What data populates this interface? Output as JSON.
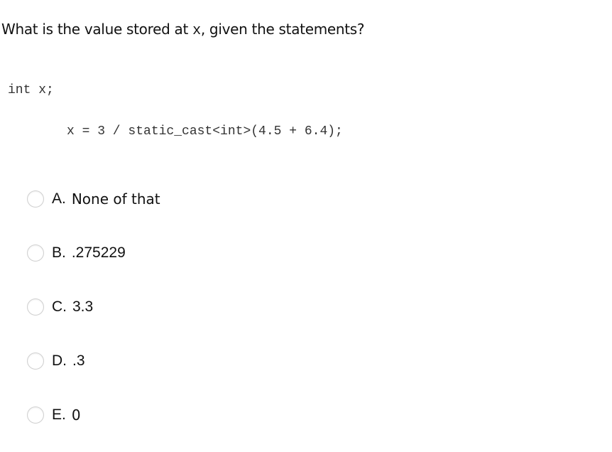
{
  "question": {
    "prefix": "What is the value stored at ",
    "variable": "x",
    "suffix": ", given the statements?"
  },
  "code": {
    "line1": "int x;",
    "line2": "x = 3 / static_cast<int>(4.5 + 6.4);"
  },
  "options": [
    {
      "letter": "A.",
      "text": "None of that",
      "selected": false
    },
    {
      "letter": "B.",
      "text": ".275229",
      "selected": false
    },
    {
      "letter": "C.",
      "text": "3.3",
      "selected": false
    },
    {
      "letter": "D.",
      "text": ".3",
      "selected": false
    },
    {
      "letter": "E.",
      "text": "0",
      "selected": false
    }
  ]
}
